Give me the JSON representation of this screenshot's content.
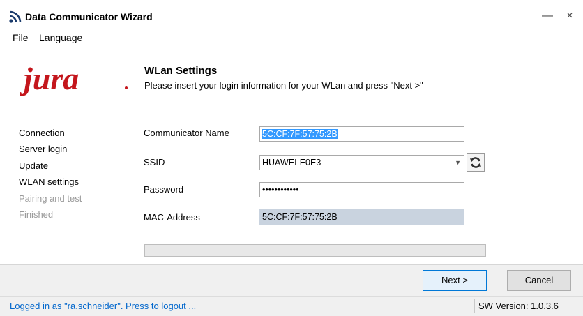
{
  "window": {
    "title": "Data Communicator Wizard",
    "app_icon": "wifi-signal-icon",
    "minimize_label": "—",
    "close_label": "×"
  },
  "menu": [
    "File",
    "Language"
  ],
  "brand": {
    "logo_text": "jura",
    "logo_color": "#c4161c"
  },
  "header": {
    "title": "WLan Settings",
    "subtitle": "Please insert your login information for your WLan and press \"Next >\""
  },
  "steps": [
    {
      "label": "Connection",
      "state": "done"
    },
    {
      "label": "Server login",
      "state": "done"
    },
    {
      "label": "Update",
      "state": "done"
    },
    {
      "label": "WLAN settings",
      "state": "current"
    },
    {
      "label": "Pairing and test",
      "state": "pending"
    },
    {
      "label": "Finished",
      "state": "pending"
    }
  ],
  "form": {
    "communicator_name": {
      "label": "Communicator Name",
      "value": "5C:CF:7F:57:75:2B"
    },
    "ssid": {
      "label": "SSID",
      "value": "HUAWEI-E0E3",
      "refresh_icon": "refresh-icon"
    },
    "password": {
      "label": "Password",
      "value": "••••••••••••"
    },
    "mac_address": {
      "label": "MAC-Address",
      "value": "5C:CF:7F:57:75:2B"
    }
  },
  "progress": {
    "value": 0
  },
  "buttons": {
    "next": "Next >",
    "cancel": "Cancel"
  },
  "status": {
    "login_text": "Logged in as \"ra.schneider\". Press to logout ...",
    "version_text": "SW Version:  1.0.3.6"
  }
}
